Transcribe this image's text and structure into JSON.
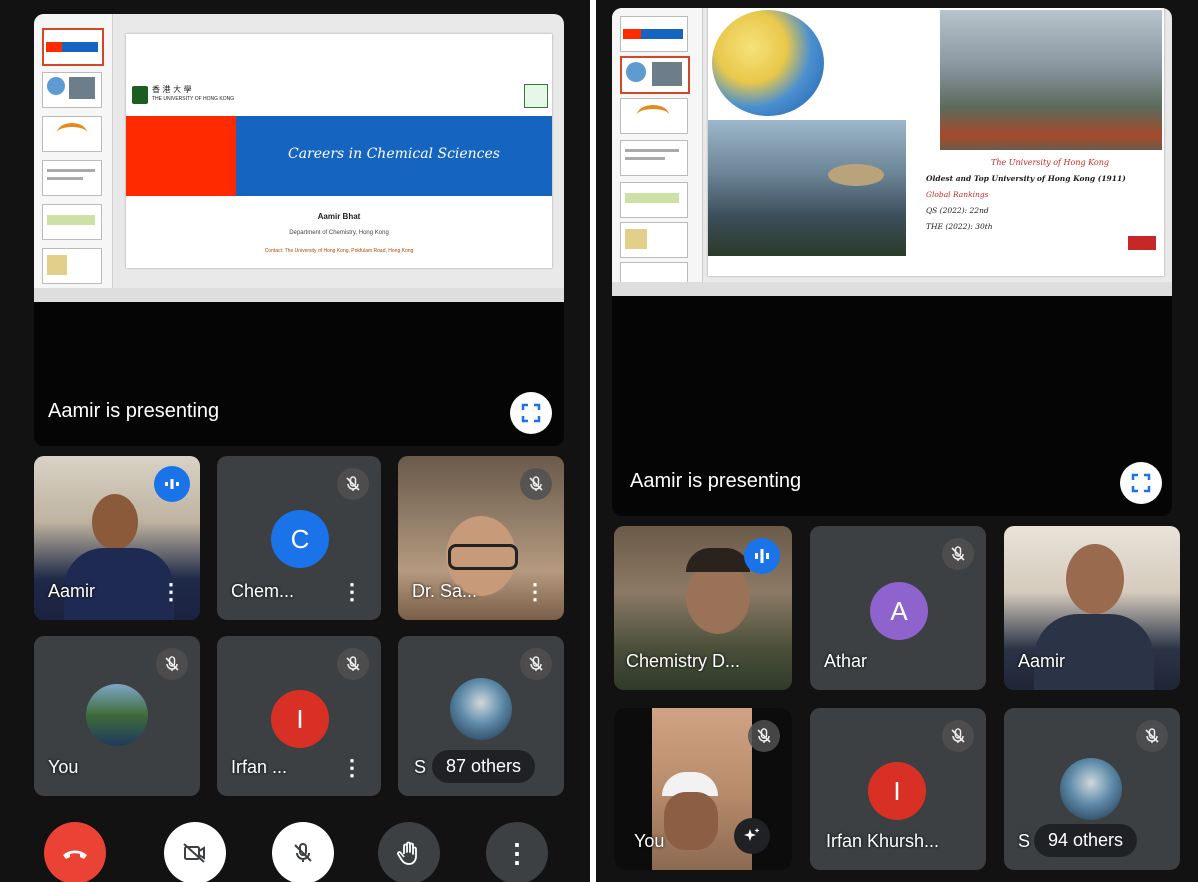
{
  "left": {
    "presenting_label": "Aamir is presenting",
    "slide": {
      "uni_name_zh": "香 港 大 學",
      "uni_name_en": "THE UNIVERSITY OF HONG KONG",
      "title": "Careers in Chemical Sciences",
      "speaker": "Aamir Bhat",
      "speaker_line": "Department of Chemistry, Hong Kong",
      "footer_line": "Contact: The University of Hong Kong, Pokfulam Road, Hong Kong"
    },
    "participants": [
      {
        "name": "Aamir",
        "state": "speaking"
      },
      {
        "name": "Chem...",
        "avatar_letter": "C",
        "avatar_color": "#1a73e8",
        "state": "muted"
      },
      {
        "name": "Dr. Sa...",
        "state": "muted"
      },
      {
        "name": "You",
        "state": "muted"
      },
      {
        "name": "Irfan ...",
        "avatar_letter": "I",
        "avatar_color": "#d93025",
        "state": "muted"
      },
      {
        "name": "S",
        "others": "87 others",
        "state": "muted"
      }
    ],
    "controls": [
      "end-call",
      "camera-off",
      "mic-off",
      "raise-hand",
      "more-options"
    ]
  },
  "right": {
    "presenting_label": "Aamir is presenting",
    "slide": {
      "title": "The University of Hong Kong",
      "subtitle": "Oldest and Top University of Hong Kong (1911)",
      "rankings_label": "Global Rankings",
      "rank_qs": "QS (2022): 22nd",
      "rank_the": "THE (2022): 30th"
    },
    "participants": [
      {
        "name": "Chemistry D...",
        "state": "speaking"
      },
      {
        "name": "Athar",
        "avatar_letter": "A",
        "avatar_color": "#8e63ce",
        "state": "muted"
      },
      {
        "name": "Aamir",
        "state": "video"
      },
      {
        "name": "You",
        "state": "muted"
      },
      {
        "name": "Irfan Khursh...",
        "avatar_letter": "I",
        "avatar_color": "#d93025",
        "state": "muted"
      },
      {
        "name": "S",
        "others": "94 others",
        "state": "muted"
      }
    ]
  },
  "colors": {
    "end_call": "#ea4335",
    "speaking": "#1a73e8",
    "tile_bg": "#3c4043",
    "hku_blue": "#1565c0",
    "hku_red": "#ff2a00"
  }
}
